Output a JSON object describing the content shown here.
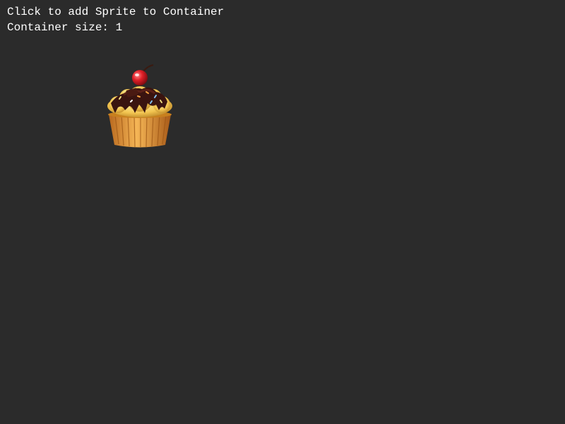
{
  "hud": {
    "instruction": "Click to add Sprite to Container",
    "container_size_label": "Container size: 1"
  },
  "container": {
    "size": 1,
    "sprites": [
      {
        "name": "cupcake-sprite",
        "icon": "cupcake-icon"
      }
    ]
  },
  "colors": {
    "background": "#2b2b2b",
    "text": "#ffffff",
    "wrapper": "#e0a040",
    "frosting": "#f2c860",
    "chocolate": "#3a1410",
    "cherry": "#d8202a"
  }
}
